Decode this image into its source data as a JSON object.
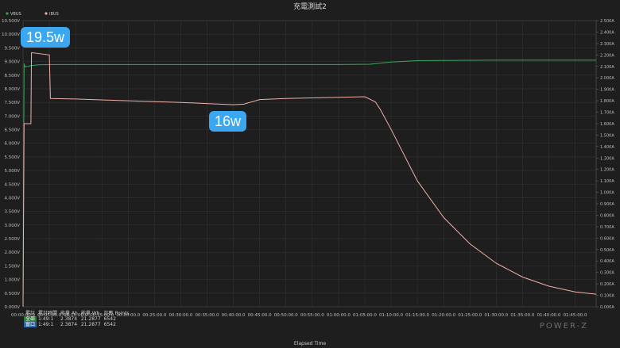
{
  "chart_data": {
    "type": "line",
    "title": "充電測試2",
    "xlabel": "Elapsed Time",
    "legend": [
      "VBUS",
      "IBUS"
    ],
    "x_ticks": [
      "00:00:00.0",
      "00:05:00.0",
      "00:10:00.0",
      "00:15:00.0",
      "00:20:00.0",
      "00:25:00.0",
      "00:30:00.0",
      "00:35:00.0",
      "00:40:00.0",
      "00:45:00.0",
      "00:50:00.0",
      "00:55:00.0",
      "01:00:00.0",
      "01:05:00.0",
      "01:10:00.0",
      "01:15:00.0",
      "01:20:00.0",
      "01:25:00.0",
      "01:30:00.0",
      "01:35:00.0",
      "01:40:00.0",
      "01:45:00.0"
    ],
    "y_left_ticks": [
      "0.000V",
      "0.500V",
      "1.000V",
      "1.500V",
      "2.000V",
      "2.500V",
      "3.000V",
      "3.500V",
      "4.000V",
      "4.500V",
      "5.000V",
      "5.500V",
      "6.000V",
      "6.500V",
      "7.000V",
      "7.500V",
      "8.000V",
      "8.500V",
      "9.000V",
      "9.500V",
      "10.000V",
      "10.500V"
    ],
    "y_right_ticks": [
      "0.000A",
      "0.100A",
      "0.200A",
      "0.300A",
      "0.400A",
      "0.500A",
      "0.600A",
      "0.700A",
      "0.800A",
      "0.900A",
      "1.000A",
      "1.100A",
      "1.200A",
      "1.300A",
      "1.400A",
      "1.500A",
      "1.600A",
      "1.700A",
      "1.800A",
      "1.900A",
      "2.000A",
      "2.100A",
      "2.200A",
      "2.300A",
      "2.400A",
      "2.500A"
    ],
    "xlim_min": [
      0,
      109
    ],
    "ylim_left": [
      0,
      10.5
    ],
    "ylim_right": [
      0,
      2.5
    ],
    "series": [
      {
        "name": "VBUS",
        "axis": "left",
        "color": "#3aa55a",
        "x": [
          0,
          0.2,
          0.4,
          1.5,
          3,
          6,
          10,
          20,
          30,
          40,
          50,
          60,
          66,
          70,
          75,
          80,
          90,
          100,
          109
        ],
        "y": [
          0,
          8.92,
          8.8,
          8.85,
          8.88,
          8.89,
          8.89,
          8.89,
          8.89,
          8.89,
          8.89,
          8.89,
          8.9,
          8.98,
          9.03,
          9.04,
          9.05,
          9.05,
          9.05
        ]
      },
      {
        "name": "IBUS",
        "axis": "right",
        "color": "#f0b0a8",
        "x": [
          0,
          0.2,
          1.5,
          1.6,
          5,
          5.2,
          10,
          20,
          30,
          40,
          42,
          45,
          50,
          60,
          65,
          67,
          68,
          70,
          75,
          80,
          85,
          90,
          95,
          100,
          105,
          109
        ],
        "y": [
          0,
          1.6,
          1.6,
          2.22,
          2.2,
          1.82,
          1.815,
          1.8,
          1.785,
          1.765,
          1.77,
          1.81,
          1.82,
          1.83,
          1.835,
          1.79,
          1.72,
          1.55,
          1.1,
          0.78,
          0.55,
          0.38,
          0.26,
          0.18,
          0.13,
          0.11
        ]
      }
    ]
  },
  "callouts": {
    "peak": "19.5w",
    "steady": "16w"
  },
  "stats": {
    "headers": [
      "累計",
      "累計時間",
      "能量 Ah",
      "能量 Wh",
      "計數 Points"
    ],
    "rows": [
      {
        "label": "全部",
        "time": "1:49:1",
        "ah": "2.3874",
        "wh": "21.2877",
        "points": "6542"
      },
      {
        "label": "窗口",
        "time": "1:49:1",
        "ah": "2.3874",
        "wh": "21.2877",
        "points": "6542"
      }
    ]
  },
  "logo": "POWER-Z"
}
